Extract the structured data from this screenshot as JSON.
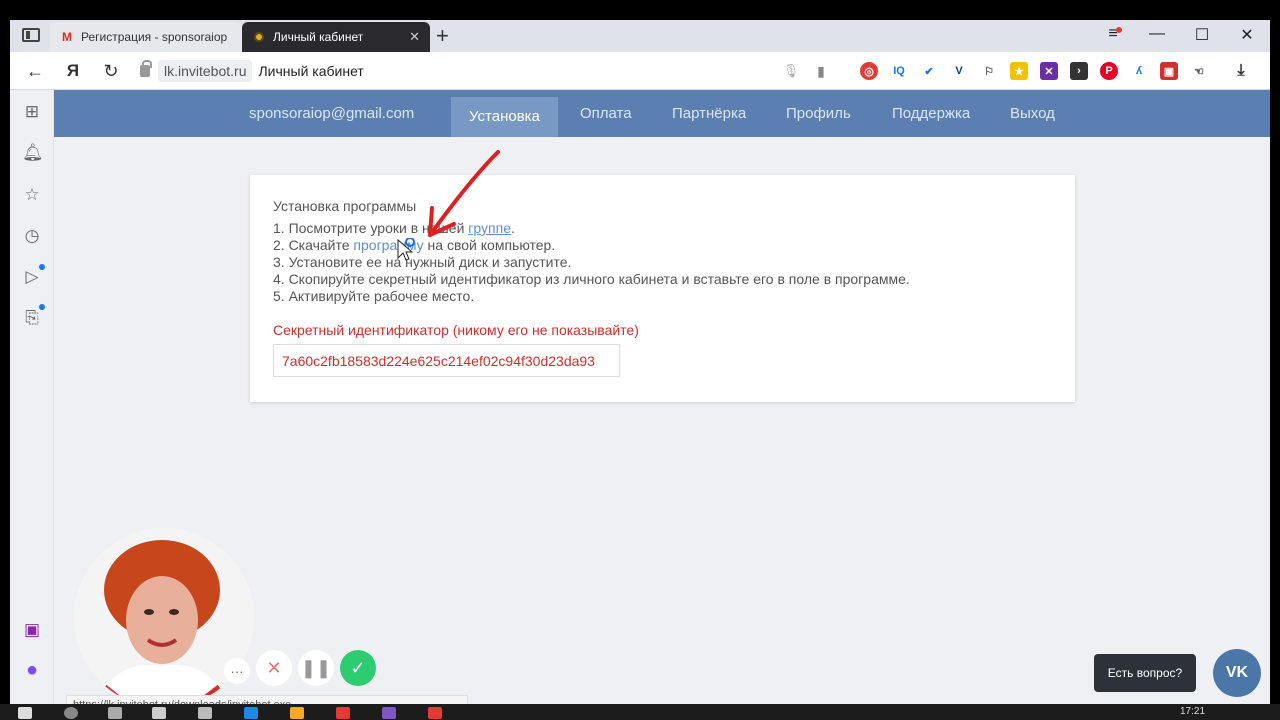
{
  "browser": {
    "tabs": [
      {
        "label": "Регистрация - sponsoraiop",
        "icon": "gmail-icon"
      },
      {
        "label": "Личный кабинет",
        "icon": "site-icon"
      }
    ],
    "address": {
      "domain": "lk.invitebot.ru",
      "title": "Личный кабинет"
    },
    "status_url": "https://lk.invitebot.ru/downloads/invitebot.exe"
  },
  "nav": {
    "email": "sponsoraiop@gmail.com",
    "items": [
      "Установка",
      "Оплата",
      "Партнёрка",
      "Профиль",
      "Поддержка",
      "Выход"
    ],
    "active": "Установка"
  },
  "install": {
    "title": "Установка программы",
    "steps": [
      {
        "prefix": "1. Посмотрите уроки в нашей ",
        "link": "группе",
        "suffix": "."
      },
      {
        "prefix": "2. Скачайте ",
        "link": "программу",
        "suffix": " на свой компьютер."
      },
      {
        "text": "3. Установите ее на нужный диск и запустите."
      },
      {
        "text": "4. Скопируйте секретный идентификатор из личного кабинета и вставьте его в поле в программе."
      },
      {
        "text": "5. Активируйте рабочее место."
      }
    ],
    "secret_label": "Секретный идентификатор (никому его не показывайте)",
    "secret_value": "7a60c2fb18583d224e625c214ef02c94f30d23da93"
  },
  "chat": {
    "bubble": "Есть вопрос?",
    "button": "VK"
  },
  "taskbar": {
    "time": "17:21"
  },
  "colors": {
    "nav_bg": "#5b7fb0",
    "nav_active": "#7799c4",
    "link": "#5b8fd0",
    "danger": "#c9302c"
  }
}
